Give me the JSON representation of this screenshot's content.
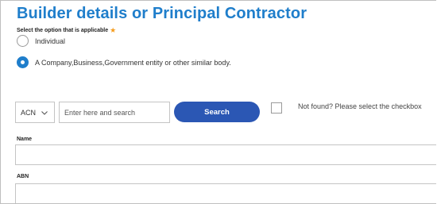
{
  "section": {
    "title": "Builder details or Principal Contractor",
    "prompt": "Select the option that is applicable",
    "required_marker": "★"
  },
  "options": [
    {
      "label": "Individual",
      "selected": false
    },
    {
      "label": "A Company,Business,Government entity or other similar body.",
      "selected": true
    }
  ],
  "search": {
    "type_selected": "ACN",
    "placeholder": "Enter here and search",
    "button_label": "Search",
    "not_found_label": "Not found? Please select the checkbox"
  },
  "fields": {
    "name_label": "Name",
    "abn_label": "ABN"
  },
  "colors": {
    "title": "#1f7ecb",
    "radio_selected": "#1f7ecb",
    "button": "#2b57b4",
    "required": "#f59b1b"
  }
}
